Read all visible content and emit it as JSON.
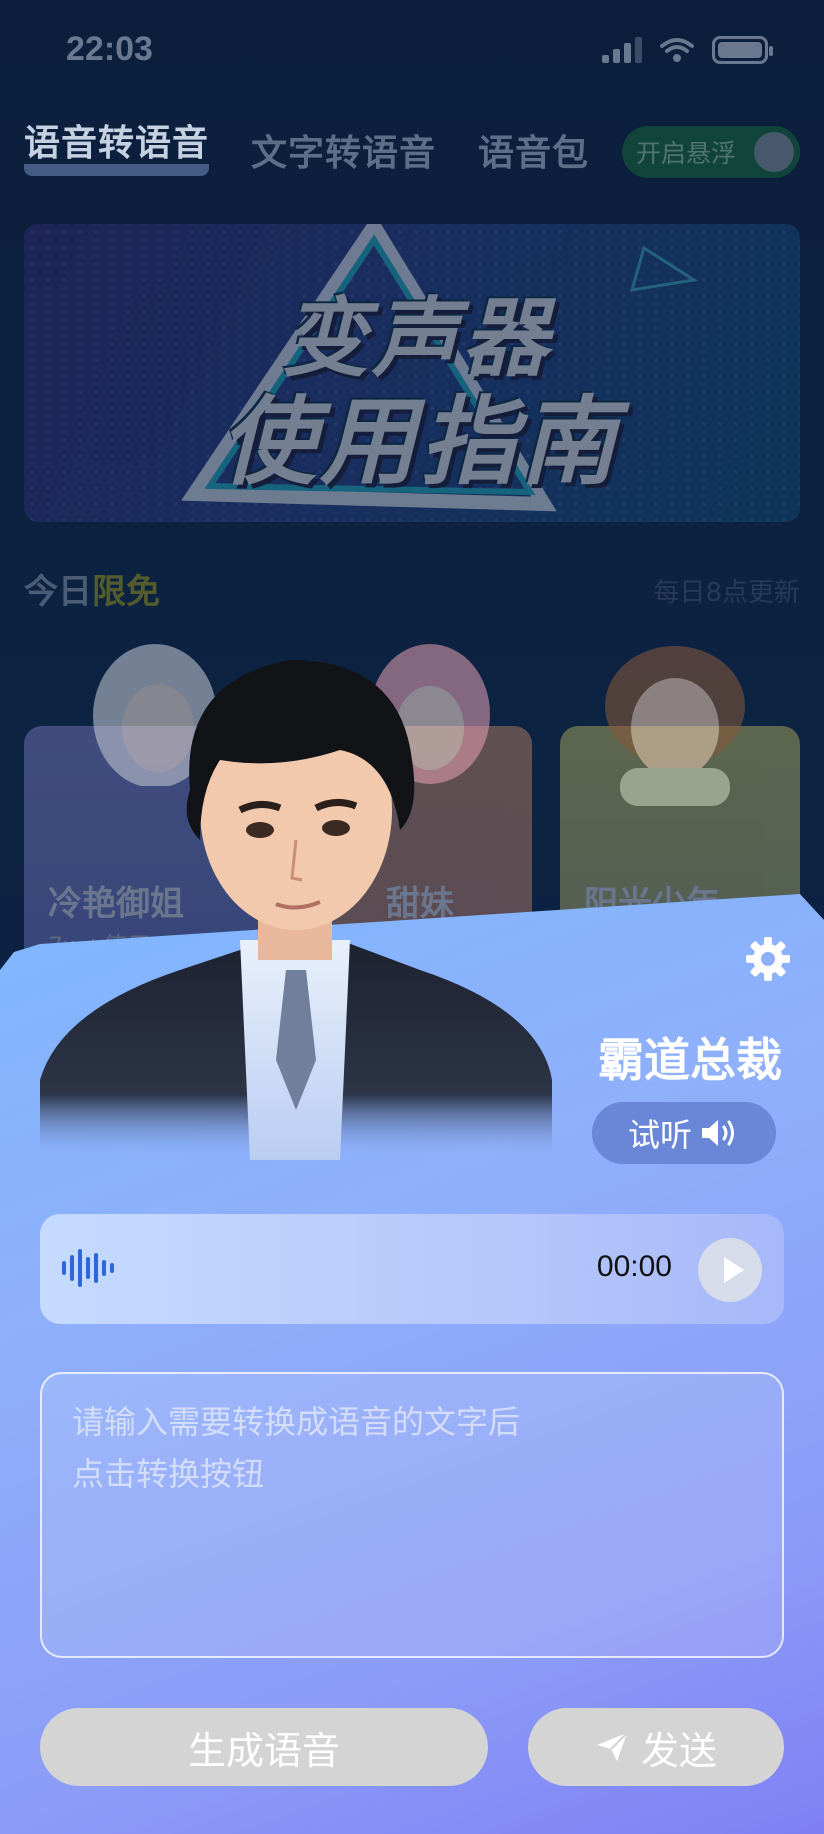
{
  "status_bar": {
    "time": "22:03",
    "icons": [
      "signal-icon",
      "wifi-icon",
      "battery-icon"
    ]
  },
  "tabs": [
    {
      "label": "语音转语音",
      "active": true
    },
    {
      "label": "文字转语音",
      "active": false
    },
    {
      "label": "语音包",
      "active": false
    }
  ],
  "float_toggle": {
    "label": "开启悬浮",
    "on": true
  },
  "banner": {
    "line1": "变声器",
    "line2": "使用指南"
  },
  "section": {
    "title_prefix": "今日",
    "title_highlight": "限免",
    "note": "每日8点更新"
  },
  "voice_cards": [
    {
      "name": "冷艳御姐",
      "uses": "7w+使用"
    },
    {
      "name": "甜妹",
      "uses": ""
    },
    {
      "name": "阳光少年",
      "uses": ""
    }
  ],
  "sheet": {
    "voice_name": "霸道总裁",
    "listen_label": "试听",
    "audio_time": "00:00",
    "input_placeholder": "请输入需要转换成语音的文字后\n点击转换按钮",
    "generate_label": "生成语音",
    "send_label": "发送"
  },
  "colors": {
    "toggle_on": "#16623a",
    "highlight": "#8e8c1e",
    "sheet_gradient_start": "#7fb7ff",
    "sheet_gradient_end": "#7e80f4",
    "button_disabled": "#d4d4d4",
    "wave_icon": "#2f66d9"
  }
}
